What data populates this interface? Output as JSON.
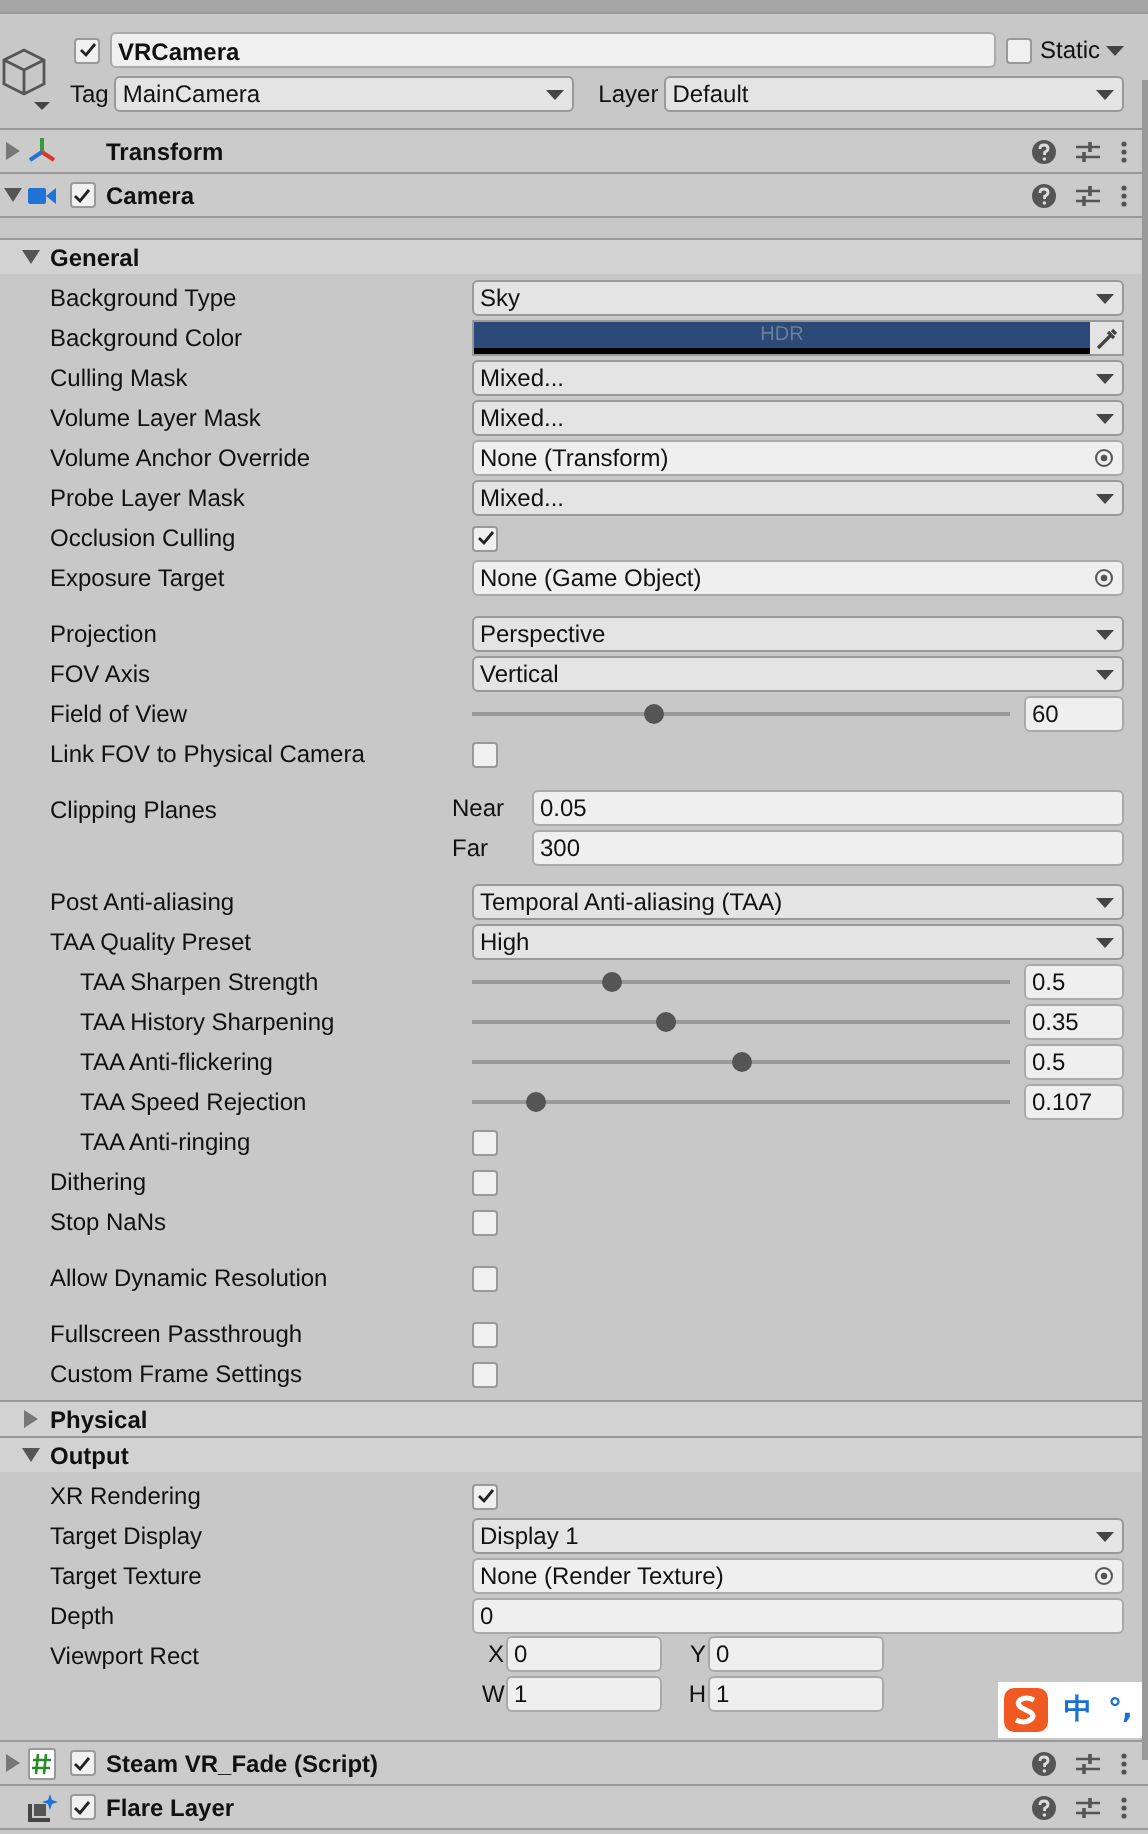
{
  "object": {
    "active": true,
    "name": "VRCamera",
    "static": false,
    "static_label": "Static",
    "tag_label": "Tag",
    "tag": "MainCamera",
    "layer_label": "Layer",
    "layer": "Default"
  },
  "components": [
    {
      "title": "Transform",
      "kind": "transform",
      "expanded": false
    },
    {
      "title": "Camera",
      "kind": "camera",
      "expanded": true,
      "enabled": true,
      "sections": [
        {
          "title": "General",
          "expanded": true,
          "rows": [
            {
              "label": "Background Type",
              "kind": "dropdown",
              "value": "Sky"
            },
            {
              "label": "Background Color",
              "kind": "color",
              "value": "HDR",
              "color": "#2c4a78"
            },
            {
              "label": "Culling Mask",
              "kind": "dropdown",
              "value": "Mixed..."
            },
            {
              "label": "Volume Layer Mask",
              "kind": "dropdown",
              "value": "Mixed..."
            },
            {
              "label": "Volume Anchor Override",
              "kind": "object",
              "value": "None (Transform)"
            },
            {
              "label": "Probe Layer Mask",
              "kind": "dropdown",
              "value": "Mixed..."
            },
            {
              "label": "Occlusion Culling",
              "kind": "checkbox",
              "checked": true
            },
            {
              "label": "Exposure Target",
              "kind": "object",
              "value": "None (Game Object)"
            },
            {
              "label": "Projection",
              "kind": "dropdown",
              "value": "Perspective",
              "spaced": true
            },
            {
              "label": "FOV Axis",
              "kind": "dropdown",
              "value": "Vertical"
            },
            {
              "label": "Field of View",
              "kind": "slider",
              "level": 0.34,
              "value": "60"
            },
            {
              "label": "Link FOV to Physical Camera",
              "kind": "checkbox",
              "checked": false
            },
            {
              "label": "Clipping Planes",
              "kind": "fields",
              "spaced": true,
              "fields": [
                {
                  "label": "Near",
                  "value": "0.05"
                },
                {
                  "label": "Far",
                  "value": "300"
                }
              ]
            },
            {
              "label": "Post Anti-aliasing",
              "kind": "dropdown",
              "value": "Temporal Anti-aliasing (TAA)",
              "spaced": true
            },
            {
              "label": "TAA Quality Preset",
              "kind": "dropdown",
              "value": "High",
              "children": [
                {
                  "label": "TAA Sharpen Strength",
                  "kind": "slider",
                  "level": 0.26,
                  "value": "0.5"
                },
                {
                  "label": "TAA History Sharpening",
                  "kind": "slider",
                  "level": 0.36,
                  "value": "0.35"
                },
                {
                  "label": "TAA Anti-flickering",
                  "kind": "slider",
                  "level": 0.5,
                  "value": "0.5"
                },
                {
                  "label": "TAA Speed Rejection",
                  "kind": "slider",
                  "level": 0.12,
                  "value": "0.107"
                },
                {
                  "label": "TAA Anti-ringing",
                  "kind": "checkbox",
                  "checked": false
                }
              ]
            },
            {
              "label": "Dithering",
              "kind": "checkbox",
              "checked": false
            },
            {
              "label": "Stop NaNs",
              "kind": "checkbox",
              "checked": false
            },
            {
              "label": "Allow Dynamic Resolution",
              "kind": "checkbox",
              "checked": false,
              "spaced": true
            },
            {
              "label": "Fullscreen Passthrough",
              "kind": "checkbox",
              "checked": false,
              "spaced": true
            },
            {
              "label": "Custom Frame Settings",
              "kind": "checkbox",
              "checked": false
            }
          ]
        },
        {
          "title": "Physical",
          "expanded": false
        },
        {
          "title": "Output",
          "expanded": true,
          "rows": [
            {
              "label": "XR Rendering",
              "kind": "checkbox",
              "checked": true
            },
            {
              "label": "Target Display",
              "kind": "dropdown",
              "value": "Display 1"
            },
            {
              "label": "Target Texture",
              "kind": "object",
              "value": "None (Render Texture)"
            },
            {
              "label": "Depth",
              "kind": "text",
              "value": "0"
            },
            {
              "label": "Viewport Rect",
              "kind": "grid",
              "fields": [
                {
                  "label": "X",
                  "value": "0"
                },
                {
                  "label": "Y",
                  "value": "0"
                },
                {
                  "label": "W",
                  "value": "1"
                },
                {
                  "label": "H",
                  "value": "1"
                }
              ]
            }
          ]
        }
      ]
    },
    {
      "title": "Steam VR_Fade (Script)",
      "kind": "script",
      "expanded": false,
      "enabled": true
    },
    {
      "title": "Flare Layer",
      "kind": "flare",
      "enabled": true
    }
  ],
  "ime": {
    "mode": "中",
    "punct": "°,"
  }
}
